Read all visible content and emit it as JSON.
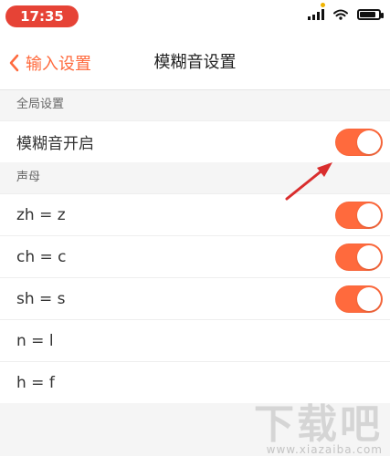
{
  "status_bar": {
    "time": "17:35"
  },
  "nav": {
    "back_label": "输入设置",
    "title": "模糊音设置"
  },
  "sections": {
    "global": {
      "title": "全局设置",
      "rows": [
        {
          "label": "模糊音开启",
          "enabled": true
        }
      ]
    },
    "initials": {
      "title": "声母",
      "rows": [
        {
          "label": "zh = z",
          "enabled": true
        },
        {
          "label": "ch = c",
          "enabled": true
        },
        {
          "label": "sh = s",
          "enabled": true
        },
        {
          "label": "n = l",
          "enabled": false
        },
        {
          "label": "h = f",
          "enabled": false
        }
      ]
    }
  },
  "watermark": {
    "logo_text": "下载吧",
    "url": "www.xiazaiba.com"
  },
  "colors": {
    "accent": "#ff6a3d",
    "time_pill": "#e64336",
    "background": "#f5f5f5",
    "arrow": "#d92d2d"
  }
}
